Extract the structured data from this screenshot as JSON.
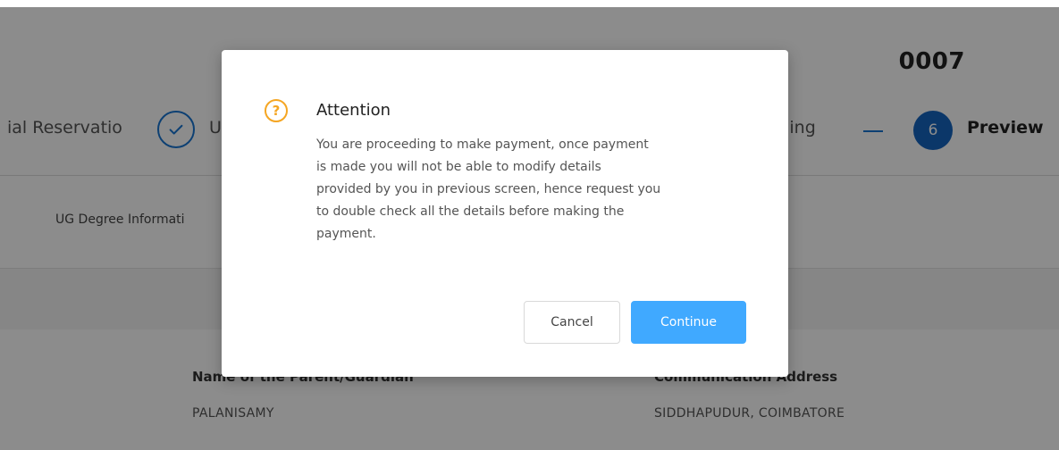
{
  "background": {
    "application_number_partial": "0007",
    "steps": {
      "left_partial_label": "ial Reservatio",
      "completed_partial_label": "U",
      "filling_partial_label": "Filling",
      "current_number": "6",
      "current_label": "Preview"
    },
    "tab_partial_label": "UG Degree Informati",
    "fields": [
      {
        "label": "Name of the Parent/Guardian",
        "value": "PALANISAMY"
      },
      {
        "label": "Communication Address",
        "value": "SIDDHAPUDUR, COIMBATORE"
      }
    ]
  },
  "modal": {
    "icon": "question-circle-icon",
    "icon_glyph": "?",
    "title": "Attention",
    "message": "You are proceeding to make payment, once payment\nis made you will not be able to modify details\nprovided by you in previous screen, hence request you\nto double check all the details before making the\npayment.",
    "cancel_label": "Cancel",
    "continue_label": "Continue"
  },
  "colors": {
    "primary": "#1565c0",
    "continue_button": "#40a9ff",
    "warning_icon": "#f5a623"
  }
}
